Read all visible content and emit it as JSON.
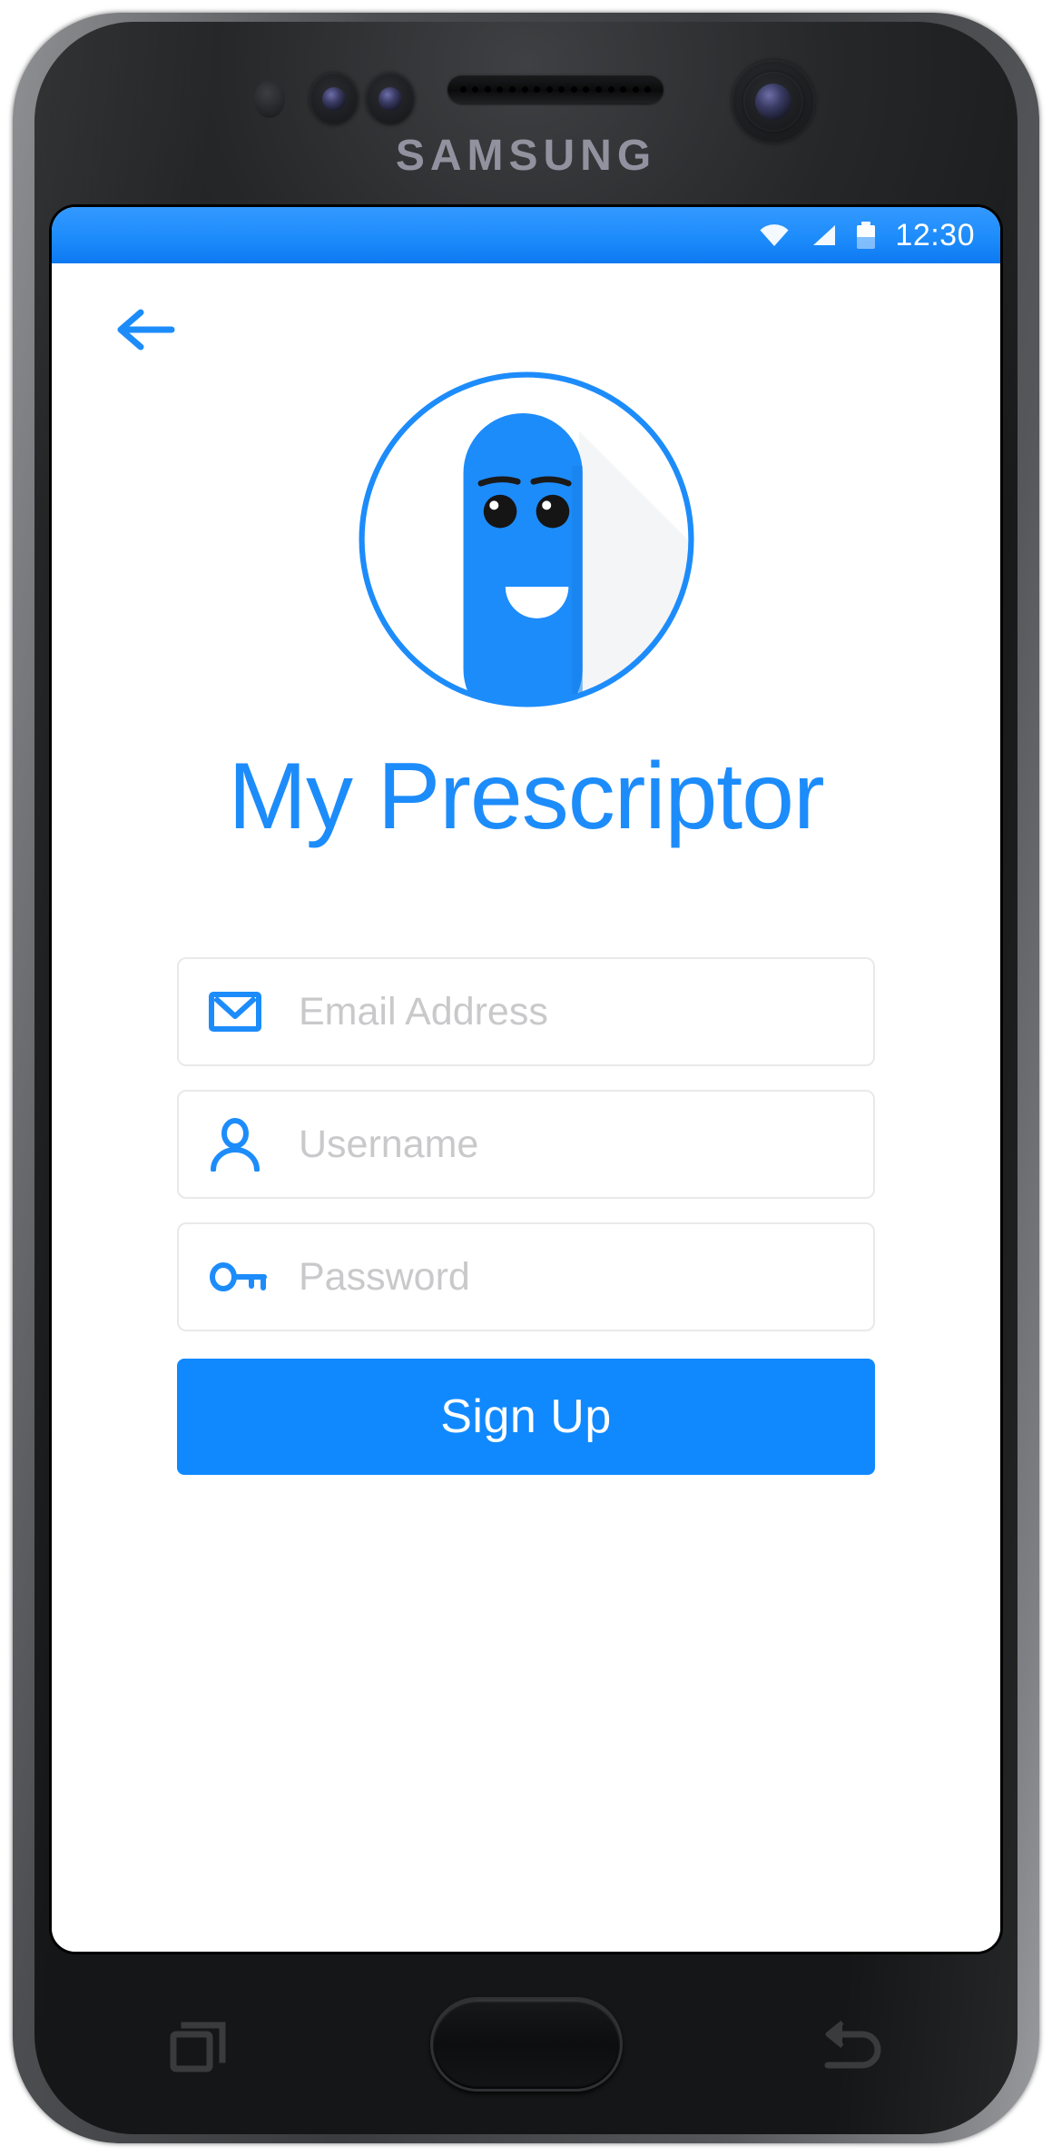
{
  "device": {
    "brand_label": "SAMSUNG",
    "speaker_icon": "speaker-grille",
    "front_camera_icon": "front-camera-lens",
    "proximity_sensor_icon": "proximity-sensor"
  },
  "statusbar": {
    "wifi_icon": "wifi-icon",
    "signal_icon": "cellular-signal-icon",
    "battery_icon": "battery-icon",
    "clock": "12:30"
  },
  "screen": {
    "back_button_icon": "back-arrow-icon",
    "logo": {
      "icon": "pill-mascot-logo",
      "description": "blue capsule character with smiling face inside circle outline"
    },
    "app_title": "My Prescriptor",
    "form": {
      "fields": [
        {
          "name": "email",
          "icon": "envelope-icon",
          "placeholder": "Email Address",
          "value": ""
        },
        {
          "name": "username",
          "icon": "person-icon",
          "placeholder": "Username",
          "value": ""
        },
        {
          "name": "password",
          "icon": "key-icon",
          "placeholder": "Password",
          "value": ""
        }
      ],
      "submit_label": "Sign Up"
    }
  },
  "navbar": {
    "recents_icon": "recents-icon",
    "home_icon": "home-button",
    "back_icon": "back-nav-icon"
  },
  "colors": {
    "accent_blue": "#1089ff",
    "statusbar_blue": "#1d8cfb",
    "placeholder_grey": "#c9c9cb",
    "field_border": "#e9e9ea",
    "phone_black": "#141516"
  }
}
